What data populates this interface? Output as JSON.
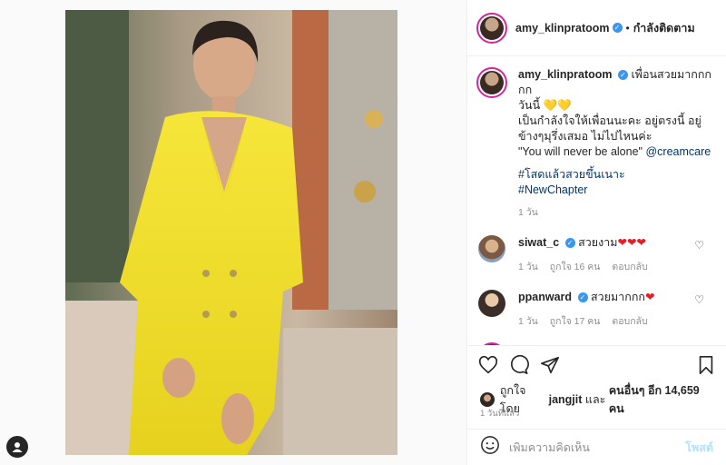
{
  "post": {
    "username": "amy_klinpratoom",
    "follow_status": "กำลังติดตาม",
    "dot": "•",
    "verified_glyph": "✓"
  },
  "caption": {
    "username": "amy_klinpratoom",
    "lines": [
      "เพื่อนสวยมากกกกก",
      "วันนี้ 💛💛",
      "เป็นกำลังใจให้เพื่อนนะคะ อยู่ตรงนี้ อยู่",
      "ข้างๆมุรึ่งเสมอ ไม่ไปไหนค่ะ",
      "\"You will never be alone\"",
      "#โสดแล้วสวยขึ้นเนาะ",
      "#NewChapter"
    ],
    "mention": "@creamcare",
    "age": "1 วัน"
  },
  "comments": [
    {
      "username": "siwat_c",
      "text": "สวยงาม",
      "hearts": "❤❤❤",
      "age": "1 วัน",
      "likes": "ถูกใจ 16 คน",
      "reply": "ตอบกลับ"
    },
    {
      "username": "ppanward",
      "text": "สวยมากกก",
      "hearts": "❤",
      "age": "1 วัน",
      "likes": "ถูกใจ 17 คน",
      "reply": "ตอบกลับ"
    }
  ],
  "likes_line": {
    "prefix": "ถูกใจโดย",
    "user": "jangjit",
    "middle": "และ",
    "others": "คนอื่นๆ อีก 14,659 คน"
  },
  "timestamp": "1 วันที่แล้ว",
  "composer": {
    "placeholder": "เพิ่มความคิดเห็น",
    "post_label": "โพสต์"
  },
  "icons": {
    "like": "heart-outline-icon",
    "comment": "speech-bubble-icon",
    "share": "paper-plane-icon",
    "save": "bookmark-icon",
    "emoji": "smiley-icon"
  }
}
